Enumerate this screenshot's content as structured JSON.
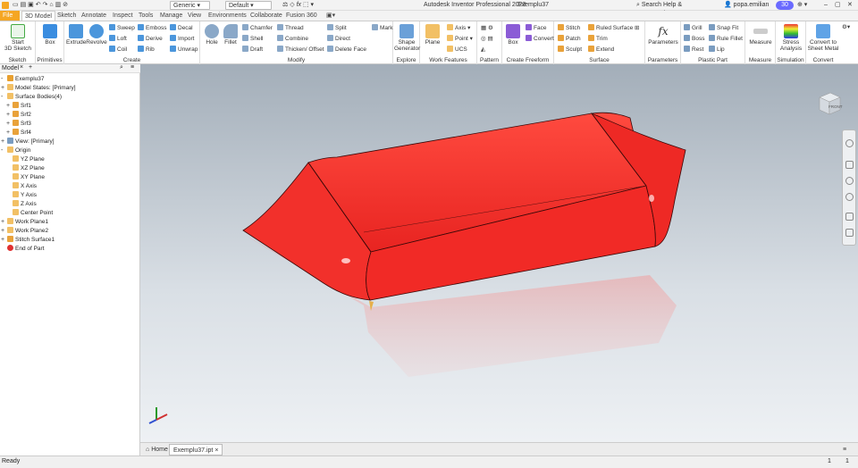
{
  "titlebar": {
    "material": "Generic",
    "appearance": "Default",
    "fx": "fx",
    "app_title": "Autodesk Inventor Professional 2023",
    "doc_title": "Exemplu37",
    "search_placeholder": "Search Help & Commands...",
    "user": "popa.emilian",
    "timer": "30"
  },
  "tabs": [
    "File",
    "3D Model",
    "Sketch",
    "Annotate",
    "Inspect",
    "Tools",
    "Manage",
    "View",
    "Environments",
    "Collaborate",
    "Fusion 360"
  ],
  "ribbon": {
    "sketch": {
      "label": "Sketch",
      "start": "Start",
      "start2": "3D Sketch"
    },
    "primitives": {
      "label": "Primitives",
      "box": "Box"
    },
    "create": {
      "label": "Create",
      "extrude": "Extrude",
      "revolve": "Revolve",
      "sweep": "Sweep",
      "loft": "Loft",
      "coil": "Coil",
      "emboss": "Emboss",
      "derive": "Derive",
      "rib": "Rib",
      "decal": "Decal",
      "import": "Import",
      "unwrap": "Unwrap"
    },
    "modify": {
      "label": "Modify",
      "hole": "Hole",
      "fillet": "Fillet",
      "chamfer": "Chamfer",
      "shell": "Shell",
      "draft": "Draft",
      "thread": "Thread",
      "combine": "Combine",
      "thicken": "Thicken/ Offset",
      "split": "Split",
      "direct": "Direct",
      "delete_face": "Delete Face",
      "mark": "Mark"
    },
    "explore": {
      "label": "Explore",
      "shape": "Shape",
      "shape2": "Generator"
    },
    "work_features": {
      "label": "Work Features",
      "plane": "Plane",
      "axis": "Axis",
      "point": "Point",
      "ucs": "UCS"
    },
    "pattern": {
      "label": "Pattern"
    },
    "freeform": {
      "label": "Create Freeform",
      "box": "Box",
      "face": "Face",
      "convert": "Convert"
    },
    "surface": {
      "label": "Surface",
      "stitch": "Stitch",
      "patch": "Patch",
      "sculpt": "Sculpt",
      "ruled": "Ruled Surface",
      "trim": "Trim",
      "extend": "Extend"
    },
    "parameters": {
      "label": "Parameters",
      "name": "Parameters"
    },
    "plastic": {
      "label": "Plastic Part",
      "grill": "Grill",
      "boss": "Boss",
      "rest": "Rest",
      "snap": "Snap Fit",
      "rule_fillet": "Rule Fillet",
      "lip": "Lip"
    },
    "measure": {
      "label": "Measure",
      "name": "Measure"
    },
    "simulation": {
      "label": "Simulation",
      "name": "Stress",
      "name2": "Analysis"
    },
    "convert": {
      "label": "Convert",
      "name": "Convert to",
      "name2": "Sheet Metal"
    }
  },
  "browser": {
    "tab": "Model",
    "nodes": [
      "Exemplu37",
      "Model States: [Primary]",
      "Surface Bodies(4)",
      "Srf1",
      "Srf2",
      "Srf3",
      "Srf4",
      "View: [Primary]",
      "Origin",
      "YZ Plane",
      "XZ Plane",
      "XY Plane",
      "X Axis",
      "Y Axis",
      "Z Axis",
      "Center Point",
      "Work Plane1",
      "Work Plane2",
      "Stitch Surface1",
      "End of Part"
    ]
  },
  "viewcube": {
    "face": "FRONT"
  },
  "doctabs": {
    "home": "Home",
    "doc": "Exemplu37.ipt"
  },
  "status": {
    "text": "Ready",
    "n1": "1",
    "n2": "1"
  },
  "colors": {
    "model": "#f02a2a",
    "accent": "#f5a623",
    "viewport_top": "#a3aeb9"
  }
}
